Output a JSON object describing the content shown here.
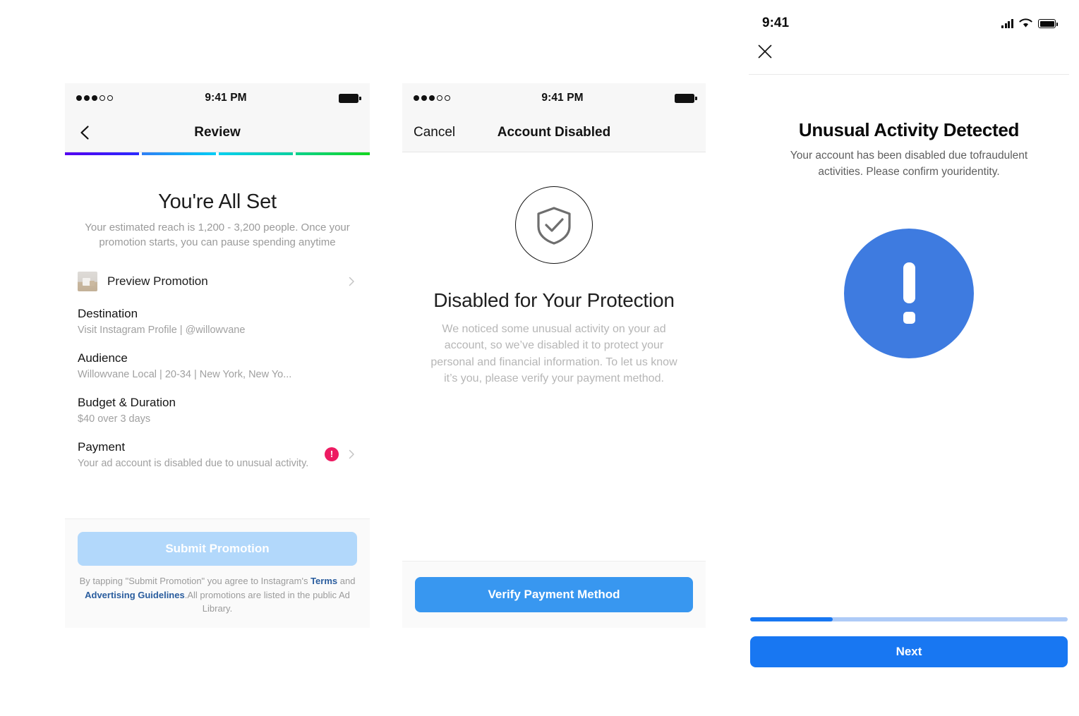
{
  "colors": {
    "ig_blue": "#3897f0",
    "fb_blue": "#1877f2",
    "alert_circle_blue": "#3e7be0",
    "warning_pink": "#ed1b62",
    "submit_disabled": "#b2d8fb",
    "link_blue": "#2a5d9e"
  },
  "review_screen": {
    "status_bar": {
      "time": "9:41 PM",
      "signal_dots_filled": 3,
      "signal_dots_total": 5,
      "battery_icon": "battery-full-icon"
    },
    "nav": {
      "back_icon": "back-chevron-icon",
      "title": "Review"
    },
    "stepper": {
      "steps": 4,
      "completed": 4
    },
    "hero": {
      "title": "You're All Set",
      "subtitle": "Your estimated reach is 1,200 - 3,200 people. Once your promotion starts, you can pause spending anytime"
    },
    "preview_row": {
      "thumbnail_icon": "promotion-thumbnail",
      "label": "Preview Promotion",
      "chevron_icon": "chevron-right-icon"
    },
    "details": [
      {
        "title": "Destination",
        "value": "Visit Instagram Profile | @willowvane"
      },
      {
        "title": "Audience",
        "value": "Willowvane Local | 20-34 | New York, New Yo..."
      },
      {
        "title": "Budget & Duration",
        "value": "$40 over 3 days"
      },
      {
        "title": "Payment",
        "value": "Your ad account is disabled due to unusual activity.",
        "has_warning": true,
        "warning_icon": "warning-exclamation-icon",
        "chevron_icon": "chevron-right-icon"
      }
    ],
    "footer": {
      "submit_label": "Submit Promotion",
      "legal_prefix": "By tapping \"Submit Promotion\" you agree to Instagram's ",
      "legal_link_terms": "Terms",
      "legal_mid": " and ",
      "legal_link_guidelines": "Advertising Guidelines",
      "legal_suffix": ".All promotions are listed in the public Ad Library."
    }
  },
  "disabled_screen": {
    "status_bar": {
      "time": "9:41 PM",
      "signal_dots_filled": 3,
      "signal_dots_total": 5,
      "battery_icon": "battery-full-icon"
    },
    "nav": {
      "cancel_label": "Cancel",
      "title": "Account Disabled"
    },
    "icon_name": "shield-check-icon",
    "title": "Disabled for Your Protection",
    "body": "We noticed some unusual activity on your ad account, so we’ve disabled it to protect your personal and financial information. To let us know it’s you, please verify your payment method.",
    "footer": {
      "verify_label": "Verify Payment Method"
    }
  },
  "unusual_activity_screen": {
    "status_bar": {
      "time": "9:41",
      "signal_icon": "cellular-signal-icon",
      "wifi_icon": "wifi-icon",
      "battery_icon": "battery-full-icon"
    },
    "close_icon": "close-x-icon",
    "title": "Unusual Activity Detected",
    "body": "Your account has been disabled due tofraudulent activities. Please confirm youridentity.",
    "alert_icon": "exclamation-circle-icon",
    "progress_percent": 26,
    "next_label": "Next"
  }
}
